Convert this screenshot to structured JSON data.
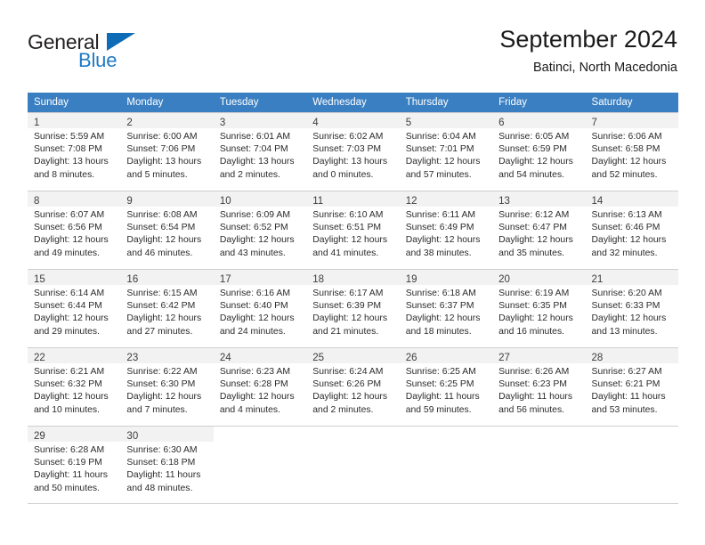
{
  "brand": {
    "name_top": "General",
    "name_bottom": "Blue",
    "triangle_color": "#0d6cb5",
    "blue_color": "#1f7ac4"
  },
  "header": {
    "title": "September 2024",
    "subtitle": "Batinci, North Macedonia"
  },
  "theme": {
    "header_row_bg": "#3a7fc1",
    "daynum_bg": "#f2f2f2",
    "grid_line": "#cfcfcf"
  },
  "weekdays": [
    "Sunday",
    "Monday",
    "Tuesday",
    "Wednesday",
    "Thursday",
    "Friday",
    "Saturday"
  ],
  "weeks": [
    [
      {
        "day": "1",
        "sunrise": "Sunrise: 5:59 AM",
        "sunset": "Sunset: 7:08 PM",
        "daylight1": "Daylight: 13 hours",
        "daylight2": "and 8 minutes."
      },
      {
        "day": "2",
        "sunrise": "Sunrise: 6:00 AM",
        "sunset": "Sunset: 7:06 PM",
        "daylight1": "Daylight: 13 hours",
        "daylight2": "and 5 minutes."
      },
      {
        "day": "3",
        "sunrise": "Sunrise: 6:01 AM",
        "sunset": "Sunset: 7:04 PM",
        "daylight1": "Daylight: 13 hours",
        "daylight2": "and 2 minutes."
      },
      {
        "day": "4",
        "sunrise": "Sunrise: 6:02 AM",
        "sunset": "Sunset: 7:03 PM",
        "daylight1": "Daylight: 13 hours",
        "daylight2": "and 0 minutes."
      },
      {
        "day": "5",
        "sunrise": "Sunrise: 6:04 AM",
        "sunset": "Sunset: 7:01 PM",
        "daylight1": "Daylight: 12 hours",
        "daylight2": "and 57 minutes."
      },
      {
        "day": "6",
        "sunrise": "Sunrise: 6:05 AM",
        "sunset": "Sunset: 6:59 PM",
        "daylight1": "Daylight: 12 hours",
        "daylight2": "and 54 minutes."
      },
      {
        "day": "7",
        "sunrise": "Sunrise: 6:06 AM",
        "sunset": "Sunset: 6:58 PM",
        "daylight1": "Daylight: 12 hours",
        "daylight2": "and 52 minutes."
      }
    ],
    [
      {
        "day": "8",
        "sunrise": "Sunrise: 6:07 AM",
        "sunset": "Sunset: 6:56 PM",
        "daylight1": "Daylight: 12 hours",
        "daylight2": "and 49 minutes."
      },
      {
        "day": "9",
        "sunrise": "Sunrise: 6:08 AM",
        "sunset": "Sunset: 6:54 PM",
        "daylight1": "Daylight: 12 hours",
        "daylight2": "and 46 minutes."
      },
      {
        "day": "10",
        "sunrise": "Sunrise: 6:09 AM",
        "sunset": "Sunset: 6:52 PM",
        "daylight1": "Daylight: 12 hours",
        "daylight2": "and 43 minutes."
      },
      {
        "day": "11",
        "sunrise": "Sunrise: 6:10 AM",
        "sunset": "Sunset: 6:51 PM",
        "daylight1": "Daylight: 12 hours",
        "daylight2": "and 41 minutes."
      },
      {
        "day": "12",
        "sunrise": "Sunrise: 6:11 AM",
        "sunset": "Sunset: 6:49 PM",
        "daylight1": "Daylight: 12 hours",
        "daylight2": "and 38 minutes."
      },
      {
        "day": "13",
        "sunrise": "Sunrise: 6:12 AM",
        "sunset": "Sunset: 6:47 PM",
        "daylight1": "Daylight: 12 hours",
        "daylight2": "and 35 minutes."
      },
      {
        "day": "14",
        "sunrise": "Sunrise: 6:13 AM",
        "sunset": "Sunset: 6:46 PM",
        "daylight1": "Daylight: 12 hours",
        "daylight2": "and 32 minutes."
      }
    ],
    [
      {
        "day": "15",
        "sunrise": "Sunrise: 6:14 AM",
        "sunset": "Sunset: 6:44 PM",
        "daylight1": "Daylight: 12 hours",
        "daylight2": "and 29 minutes."
      },
      {
        "day": "16",
        "sunrise": "Sunrise: 6:15 AM",
        "sunset": "Sunset: 6:42 PM",
        "daylight1": "Daylight: 12 hours",
        "daylight2": "and 27 minutes."
      },
      {
        "day": "17",
        "sunrise": "Sunrise: 6:16 AM",
        "sunset": "Sunset: 6:40 PM",
        "daylight1": "Daylight: 12 hours",
        "daylight2": "and 24 minutes."
      },
      {
        "day": "18",
        "sunrise": "Sunrise: 6:17 AM",
        "sunset": "Sunset: 6:39 PM",
        "daylight1": "Daylight: 12 hours",
        "daylight2": "and 21 minutes."
      },
      {
        "day": "19",
        "sunrise": "Sunrise: 6:18 AM",
        "sunset": "Sunset: 6:37 PM",
        "daylight1": "Daylight: 12 hours",
        "daylight2": "and 18 minutes."
      },
      {
        "day": "20",
        "sunrise": "Sunrise: 6:19 AM",
        "sunset": "Sunset: 6:35 PM",
        "daylight1": "Daylight: 12 hours",
        "daylight2": "and 16 minutes."
      },
      {
        "day": "21",
        "sunrise": "Sunrise: 6:20 AM",
        "sunset": "Sunset: 6:33 PM",
        "daylight1": "Daylight: 12 hours",
        "daylight2": "and 13 minutes."
      }
    ],
    [
      {
        "day": "22",
        "sunrise": "Sunrise: 6:21 AM",
        "sunset": "Sunset: 6:32 PM",
        "daylight1": "Daylight: 12 hours",
        "daylight2": "and 10 minutes."
      },
      {
        "day": "23",
        "sunrise": "Sunrise: 6:22 AM",
        "sunset": "Sunset: 6:30 PM",
        "daylight1": "Daylight: 12 hours",
        "daylight2": "and 7 minutes."
      },
      {
        "day": "24",
        "sunrise": "Sunrise: 6:23 AM",
        "sunset": "Sunset: 6:28 PM",
        "daylight1": "Daylight: 12 hours",
        "daylight2": "and 4 minutes."
      },
      {
        "day": "25",
        "sunrise": "Sunrise: 6:24 AM",
        "sunset": "Sunset: 6:26 PM",
        "daylight1": "Daylight: 12 hours",
        "daylight2": "and 2 minutes."
      },
      {
        "day": "26",
        "sunrise": "Sunrise: 6:25 AM",
        "sunset": "Sunset: 6:25 PM",
        "daylight1": "Daylight: 11 hours",
        "daylight2": "and 59 minutes."
      },
      {
        "day": "27",
        "sunrise": "Sunrise: 6:26 AM",
        "sunset": "Sunset: 6:23 PM",
        "daylight1": "Daylight: 11 hours",
        "daylight2": "and 56 minutes."
      },
      {
        "day": "28",
        "sunrise": "Sunrise: 6:27 AM",
        "sunset": "Sunset: 6:21 PM",
        "daylight1": "Daylight: 11 hours",
        "daylight2": "and 53 minutes."
      }
    ],
    [
      {
        "day": "29",
        "sunrise": "Sunrise: 6:28 AM",
        "sunset": "Sunset: 6:19 PM",
        "daylight1": "Daylight: 11 hours",
        "daylight2": "and 50 minutes."
      },
      {
        "day": "30",
        "sunrise": "Sunrise: 6:30 AM",
        "sunset": "Sunset: 6:18 PM",
        "daylight1": "Daylight: 11 hours",
        "daylight2": "and 48 minutes."
      },
      null,
      null,
      null,
      null,
      null
    ]
  ]
}
